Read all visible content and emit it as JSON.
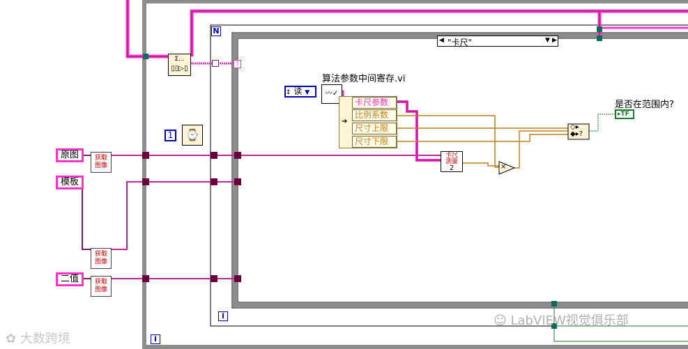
{
  "case_selector": {
    "value": "\"卡尺\"",
    "left_arrow": "◀",
    "right_arrow": "▶",
    "dropdown": "▼"
  },
  "loop_counters": {
    "outer_n": "N",
    "inner_i": "i",
    "outer_i": "i"
  },
  "subvi": {
    "title": "算法参数中间寄存.vi",
    "mode_label": "读",
    "mode_arrows": "↕"
  },
  "unbundle": {
    "items": [
      "卡尺参数",
      "比例系数",
      "尺寸上限",
      "尺寸下限"
    ]
  },
  "caliper_node": {
    "line1": "卡尺",
    "line2": "测量",
    "line3": "2"
  },
  "in_range": {
    "label": "是否在范围内?",
    "indicator": "TF"
  },
  "constant_1": "1",
  "controls": {
    "original": "原图",
    "template": "模板",
    "binary": "二值"
  },
  "get_image": {
    "label_line1": "获取",
    "label_line2": "图像"
  },
  "multiply_symbol": "×",
  "select_symbol": "?",
  "top_left_node": "Σ...",
  "watermarks": {
    "left": "大数跨境",
    "right": "LabVIEW视觉俱乐部"
  },
  "colors": {
    "pink_wire": "#ff33cc",
    "purple_wire": "#7a1a6a",
    "orange_wire": "#c08020",
    "loop_gray": "#8c8c8c",
    "structure_border": "#000000"
  }
}
